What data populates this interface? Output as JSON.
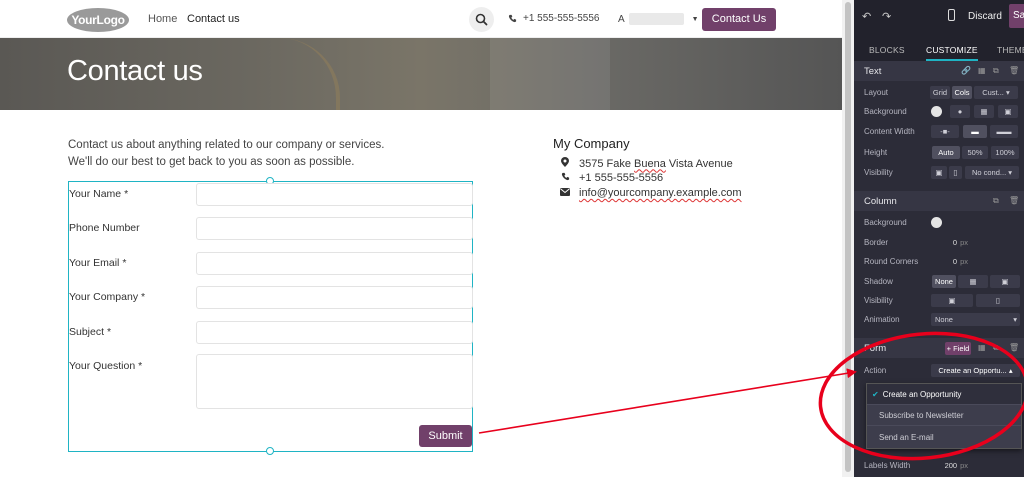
{
  "site": {
    "logo": "YourLogo",
    "nav": {
      "home": "Home",
      "contact": "Contact us",
      "phone": "+1 555-555-5556",
      "user_initial": "A",
      "cta": "Contact Us"
    },
    "hero_title": "Contact us",
    "intro_line1": "Contact us about anything related to our company or services.",
    "intro_line2": "We'll do our best to get back to you as soon as possible.",
    "form": {
      "fields": [
        {
          "label": "Your Name",
          "required": "*"
        },
        {
          "label": "Phone Number",
          "required": ""
        },
        {
          "label": "Your Email",
          "required": "*"
        },
        {
          "label": "Your Company",
          "required": "*"
        },
        {
          "label": "Subject",
          "required": "*"
        },
        {
          "label": "Your Question",
          "required": "*"
        }
      ],
      "submit": "Submit"
    },
    "company": {
      "name": "My Company",
      "address_pre": "3575 Fake ",
      "address_word": "Buena",
      "address_post": " Vista Avenue",
      "phone": "+1 555-555-5556",
      "email": "info@yourcompany.example.com"
    }
  },
  "panel": {
    "top": {
      "discard": "Discard",
      "save": "Save"
    },
    "tabs": {
      "blocks": "BLOCKS",
      "customize": "CUSTOMIZE",
      "theme": "THEME"
    },
    "text_section": {
      "title": "Text",
      "layout_label": "Layout",
      "layout_grid": "Grid",
      "layout_cols": "Cols",
      "layout_custom": "Cust...",
      "background_label": "Background",
      "content_width_label": "Content Width",
      "height_label": "Height",
      "height_auto": "Auto",
      "height_50": "50%",
      "height_100": "100%",
      "visibility_label": "Visibility",
      "visibility_value": "No cond..."
    },
    "column_section": {
      "title": "Column",
      "background_label": "Background",
      "border_label": "Border",
      "border_value": "0",
      "border_unit": "px",
      "round_label": "Round Corners",
      "round_value": "0",
      "round_unit": "px",
      "shadow_label": "Shadow",
      "shadow_none": "None",
      "visibility_label": "Visibility",
      "animation_label": "Animation",
      "animation_value": "None"
    },
    "form_section": {
      "title": "Form",
      "field_button": "+ Field",
      "action_label": "Action",
      "action_value": "Create an Opportu...",
      "options": [
        "Create an Opportunity",
        "Subscribe to Newsletter",
        "Send an E-mail"
      ],
      "labels_width_label": "Labels Width",
      "labels_width_value": "200",
      "labels_width_unit": "px"
    }
  },
  "colors": {
    "brand": "#71406a",
    "selection": "#1fb4c4",
    "annotation": "#e8001c",
    "panel_bg": "#2c2c38"
  }
}
